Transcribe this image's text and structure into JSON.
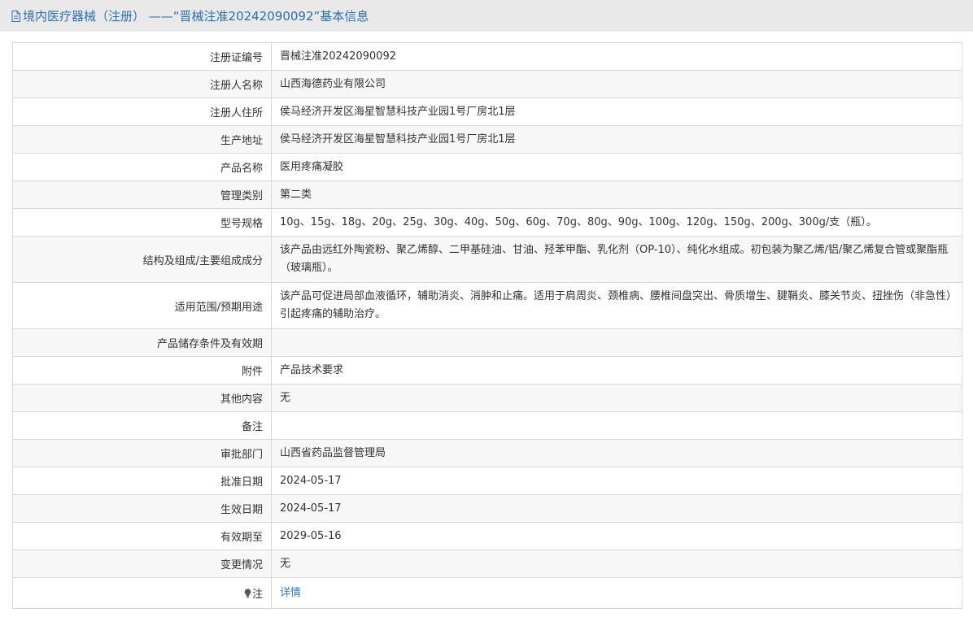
{
  "header": {
    "title": "境内医疗器械（注册） ——“晋械注准20242090092”基本信息",
    "icon": "document-icon"
  },
  "rows": [
    {
      "label": "注册证编号",
      "value": "晋械注准20242090092"
    },
    {
      "label": "注册人名称",
      "value": "山西海德药业有限公司"
    },
    {
      "label": "注册人住所",
      "value": "侯马经济开发区海星智慧科技产业园1号厂房北1层"
    },
    {
      "label": "生产地址",
      "value": "侯马经济开发区海星智慧科技产业园1号厂房北1层"
    },
    {
      "label": "产品名称",
      "value": "医用疼痛凝胶"
    },
    {
      "label": "管理类别",
      "value": "第二类"
    },
    {
      "label": "型号规格",
      "value": "10g、15g、18g、20g、25g、30g、40g、50g、60g、70g、80g、90g、100g、120g、150g、200g、300g/支（瓶）。"
    },
    {
      "label": "结构及组成/主要组成成分",
      "value": "该产品由远红外陶瓷粉、聚乙烯醇、二甲基硅油、甘油、羟苯甲酯、乳化剂（OP-10）、纯化水组成。初包装为聚乙烯/铝/聚乙烯复合管或聚酯瓶（玻璃瓶）。"
    },
    {
      "label": "适用范围/预期用途",
      "value": "该产品可促进局部血液循环，辅助消炎、消肿和止痛。适用于肩周炎、颈椎病、腰椎间盘突出、骨质增生、腱鞘炎、膝关节炎、扭挫伤（非急性）引起疼痛的辅助治疗。"
    },
    {
      "label": "产品储存条件及有效期",
      "value": ""
    },
    {
      "label": "附件",
      "value": "产品技术要求"
    },
    {
      "label": "其他内容",
      "value": "无"
    },
    {
      "label": "备注",
      "value": ""
    },
    {
      "label": "审批部门",
      "value": "山西省药品监督管理局"
    },
    {
      "label": "批准日期",
      "value": "2024-05-17"
    },
    {
      "label": "生效日期",
      "value": "2024-05-17"
    },
    {
      "label": "有效期至",
      "value": "2029-05-16"
    },
    {
      "label": "变更情况",
      "value": "无"
    }
  ],
  "note_row": {
    "label": "注",
    "icon": "lightbulb-icon",
    "link": "详情"
  },
  "colors": {
    "accent": "#2a6fb0",
    "link": "#2a7ec0",
    "header_bg": "#e9e9e9",
    "row_alt": "#f7f7f7",
    "border": "#d8d8d8"
  }
}
